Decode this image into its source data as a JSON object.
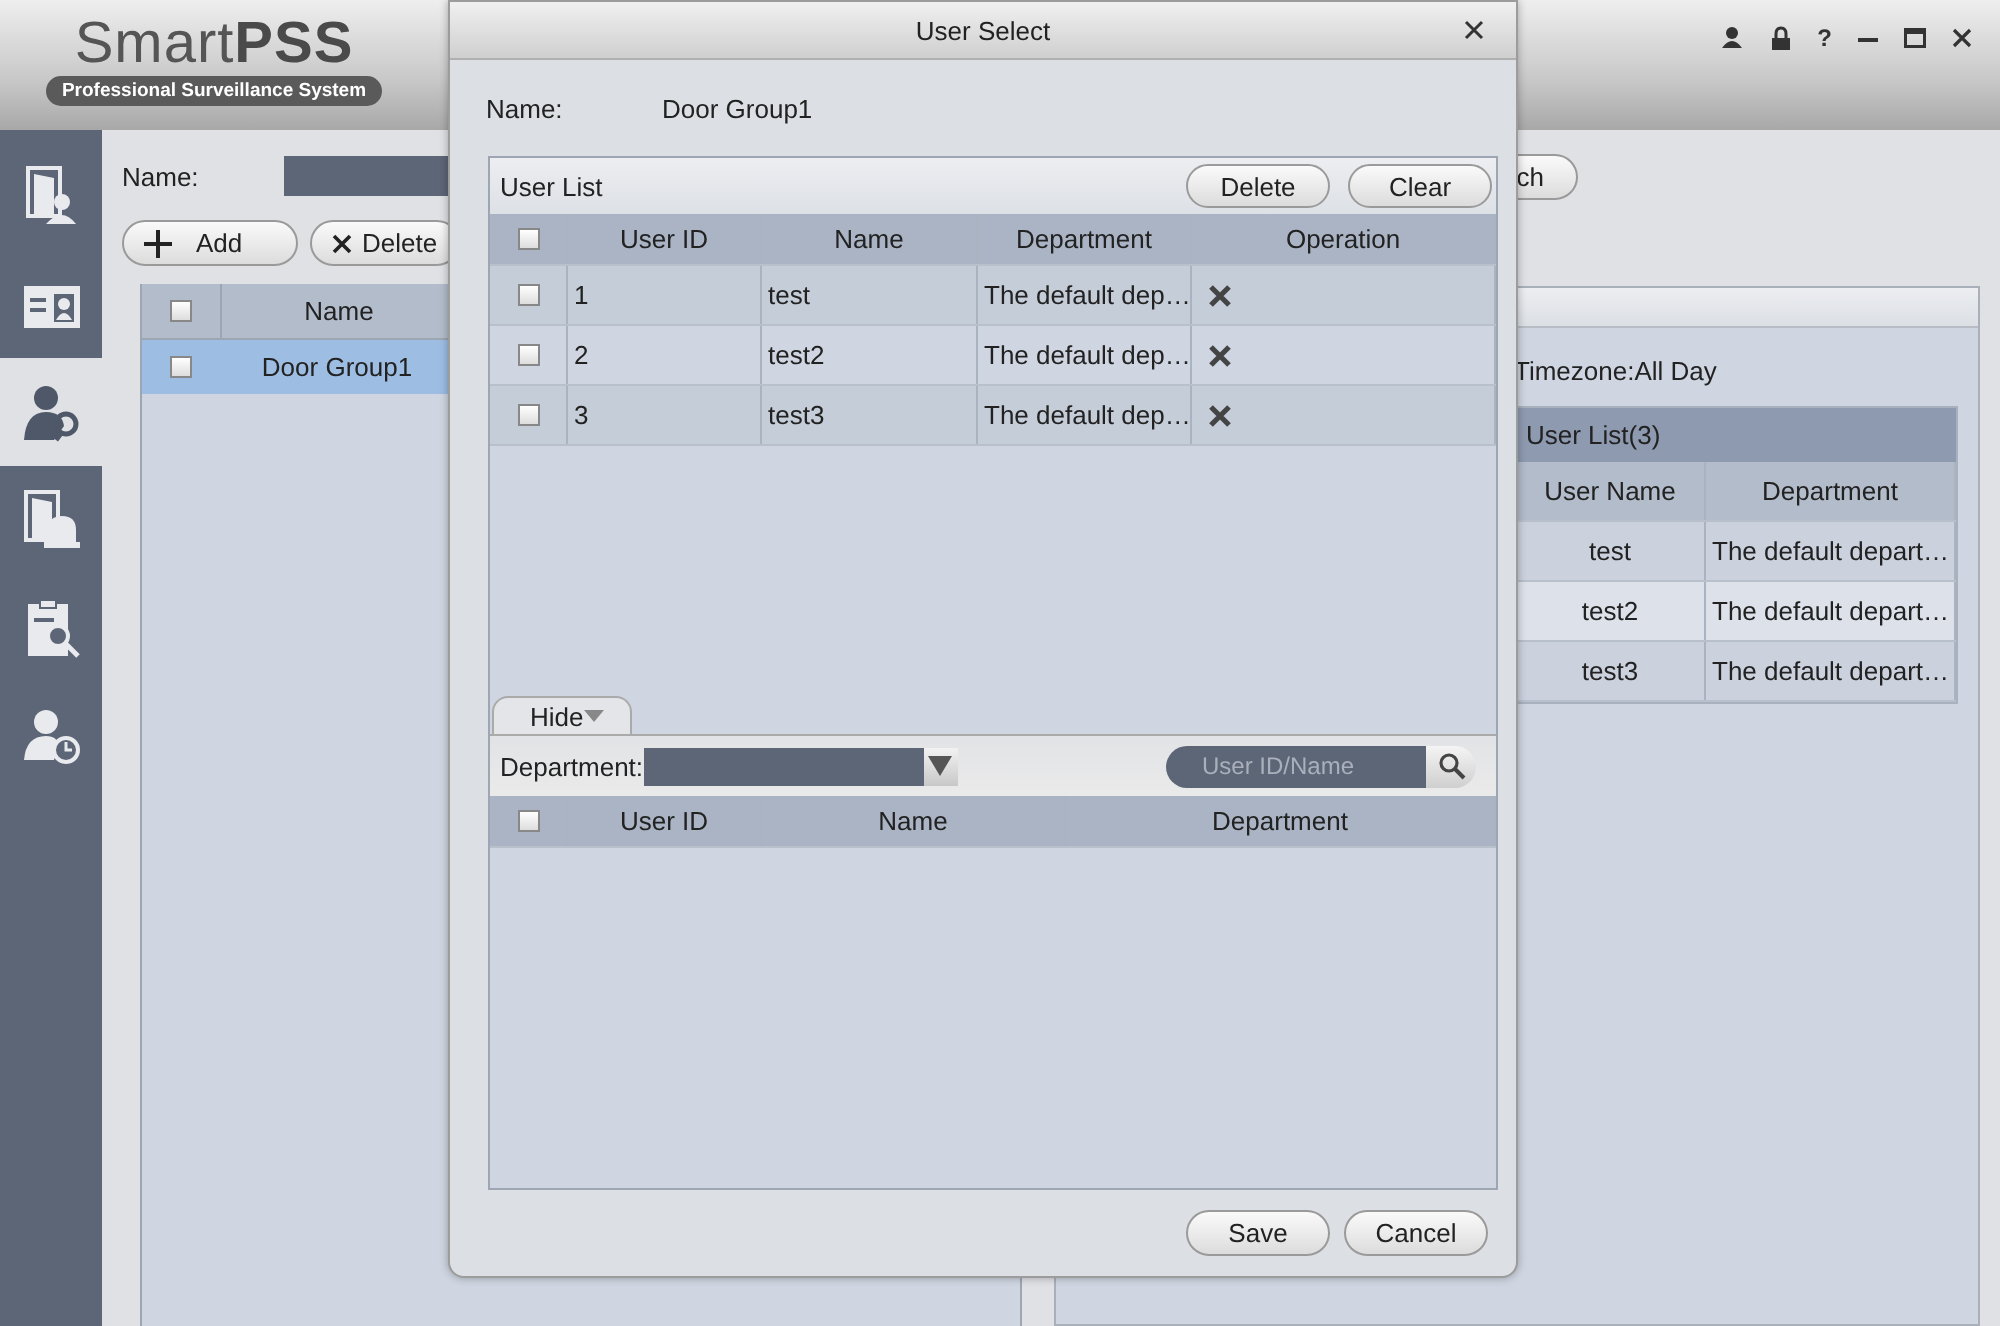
{
  "app": {
    "logo": {
      "light": "Smart",
      "bold": "PSS",
      "tagline": "Professional Surveillance System"
    },
    "help": "?",
    "sidebar": [
      {
        "kind": "door-user",
        "selected": false
      },
      {
        "kind": "id-card",
        "selected": false
      },
      {
        "kind": "user-key",
        "selected": true
      },
      {
        "kind": "door-alarm",
        "selected": false
      },
      {
        "kind": "clipboard-search",
        "selected": false
      },
      {
        "kind": "user-clock",
        "selected": false
      }
    ],
    "name_label": "Name:",
    "add_button": "Add",
    "delete_button": "Delete",
    "search_button": "ch",
    "group_table": {
      "column": "Name",
      "all_checked": false,
      "rows": [
        {
          "name": "Door Group1",
          "checked": false,
          "selected": true
        }
      ]
    },
    "timezone": "Timezone:All Day",
    "user_list": {
      "title": "User List(3)",
      "columns": [
        "User Name",
        "Department"
      ],
      "rows": [
        {
          "user_name": "test",
          "department": "The default depart…"
        },
        {
          "user_name": "test2",
          "department": "The default depart…"
        },
        {
          "user_name": "test3",
          "department": "The default depart…"
        }
      ]
    }
  },
  "dialog": {
    "title": "User Select",
    "name_label": "Name:",
    "name_value": "Door Group1",
    "user_list": {
      "title": "User List",
      "delete_button": "Delete",
      "clear_button": "Clear",
      "all_checked": false,
      "columns": [
        "User ID",
        "Name",
        "Department",
        "Operation"
      ],
      "rows": [
        {
          "user_id": "1",
          "name": "test",
          "department": "The default dep…",
          "checked": false
        },
        {
          "user_id": "2",
          "name": "test2",
          "department": "The default dep…",
          "checked": false
        },
        {
          "user_id": "3",
          "name": "test3",
          "department": "The default dep…",
          "checked": false
        }
      ]
    },
    "hide_tab": "Hide",
    "department_label": "Department:",
    "search_placeholder": "User ID/Name",
    "candidates": {
      "all_checked": false,
      "columns": [
        "User ID",
        "Name",
        "Department"
      ]
    },
    "save_button": "Save",
    "cancel_button": "Cancel"
  }
}
